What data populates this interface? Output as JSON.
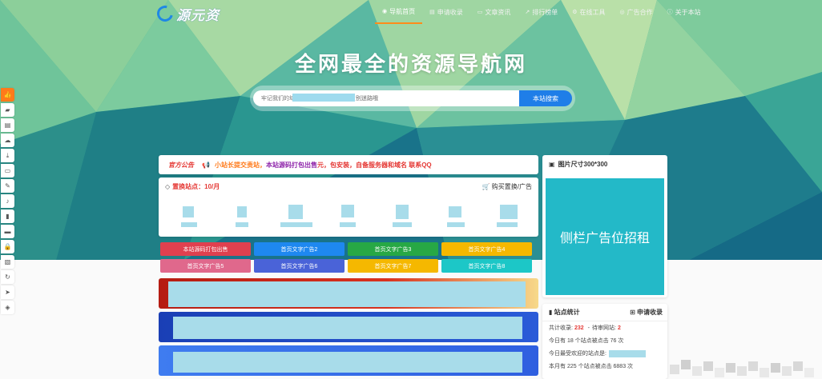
{
  "brand": {
    "logo_text": "源元资"
  },
  "nav": [
    {
      "icon": "◉",
      "label": "导航首页",
      "active": true
    },
    {
      "icon": "▤",
      "label": "申请收录"
    },
    {
      "icon": "▭",
      "label": "文章资讯"
    },
    {
      "icon": "↗",
      "label": "排行榜单"
    },
    {
      "icon": "⚙",
      "label": "在线工具"
    },
    {
      "icon": "◎",
      "label": "广告合作"
    },
    {
      "icon": "ⓘ",
      "label": "关于本站"
    }
  ],
  "hero": {
    "title": "全网最全的资源导航网"
  },
  "search": {
    "placeholder": "牢记我们的域名",
    "placeholder_suffix": "别迷路哦",
    "button": "本站搜索"
  },
  "notice": {
    "title": "官方公告",
    "text_a": "小站长提交责站，",
    "text_b": "本站源码打包出售",
    "text_c": "元，包安装，自备服务器和域名 联系QQ"
  },
  "sites": {
    "title": "置换站点：10/月",
    "buy": "购买置换/广告"
  },
  "ads": [
    {
      "label": "本站源码打包出售",
      "color": "#e0404f"
    },
    {
      "label": "首页文字广告2",
      "color": "#1e88f0"
    },
    {
      "label": "首页文字广告3",
      "color": "#27a845"
    },
    {
      "label": "首页文字广告4",
      "color": "#f5b800"
    },
    {
      "label": "首页文字广告5",
      "color": "#e0688c"
    },
    {
      "label": "首页文字广告6",
      "color": "#4a63d8"
    },
    {
      "label": "首页文字广告7",
      "color": "#f5b800"
    },
    {
      "label": "首页文字广告8",
      "color": "#1cc7c7"
    }
  ],
  "side_ad": {
    "title": "图片尺寸300*300",
    "body": "侧栏广告位招租"
  },
  "stats": {
    "title": "站点统计",
    "apply": "申请收录",
    "total_label": "共计收录:",
    "total": "232",
    "sep": "-",
    "pending_label": "待审网站:",
    "pending": "2",
    "today_line": "今日有 18 个站点被点击 76 次",
    "popular_label": "今日最受欢迎的站点是:",
    "month_line": "本月有 225 个站点被点击 6883 次"
  },
  "colors": {
    "accent": "#1f7ee8",
    "hero": "#3fb29a",
    "notice_red": "#e53935",
    "side_ad": "#23b9c8"
  }
}
